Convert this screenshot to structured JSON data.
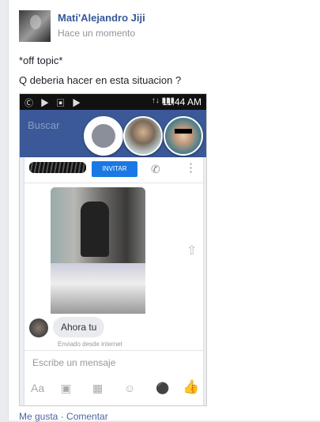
{
  "post": {
    "author": "Mati'Alejandro Jiji",
    "time": "Hace un momento",
    "line1": "*off topic*",
    "line2": "Q deberia hacer en esta situacion ?"
  },
  "screenshot": {
    "status_time": "11:44 AM",
    "status_left_icons": "Ⓒ ▶ ▣ ▶",
    "status_right_icons": "↑↓ ▮▮▮",
    "search_placeholder": "Buscar",
    "invite_label": "INVITAR",
    "chat_message": "Ahora tu",
    "sent_status": "Enviado desde internet",
    "composer_placeholder": "Escribe un mensaje",
    "tool_aa": "Aa"
  },
  "actions": {
    "like": "Me gusta",
    "separator": " · ",
    "comment": "Comentar"
  },
  "icons": [
    "messenger-icon",
    "phone-icon",
    "more-icon",
    "share-icon",
    "camera-icon",
    "image-icon",
    "emoji-icon",
    "mic-icon",
    "like-icon"
  ]
}
